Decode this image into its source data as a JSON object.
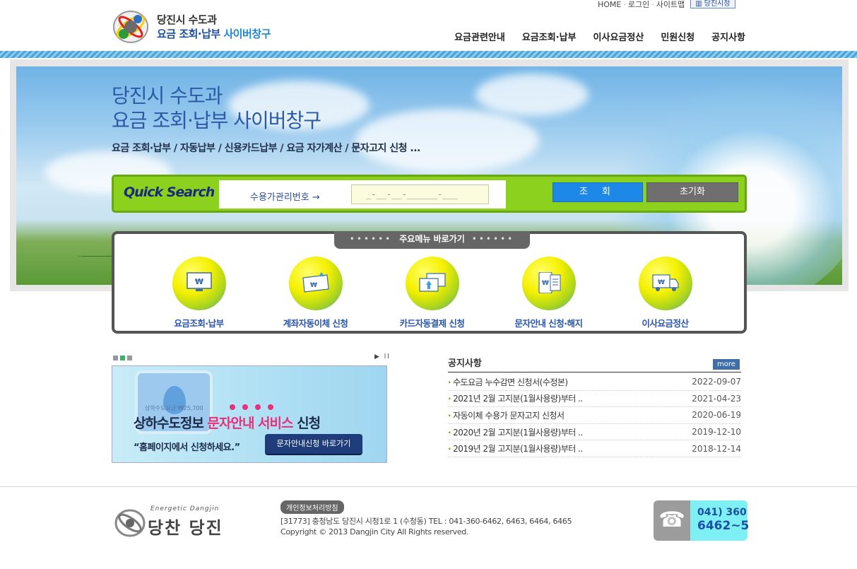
{
  "util": {
    "home": "HOME",
    "login": "로그인",
    "sitemap": "사이트맵",
    "sitemap_btn": "당진시청"
  },
  "logo": {
    "line1": "당진시 수도과",
    "line2a": "요금 조회·납부 ",
    "line2b": "사이버창구"
  },
  "gnb": [
    "요금관련안내",
    "요금조회·납부",
    "이사요금정산",
    "민원신청",
    "공지사항"
  ],
  "hero": {
    "title1": "당진시 수도과",
    "title2": "요금 조회·납부 사이버창구",
    "subtitle": "요금 조회·납부 / 자동납부 / 신용카드납부 / 요금 자가계산 / 문자고지 신청 ..."
  },
  "quick_search": {
    "logo": "Quick Search",
    "label": "수용가관리번호  →",
    "input_value": "_-__-__-______-___",
    "search_btn": "조 회",
    "reset_btn": "초기화"
  },
  "main_menu": {
    "tab_title": "주요메뉴 바로가기",
    "dots": "••••••",
    "items": [
      {
        "label": "요금조회·납부",
        "icon": "monitor-won-icon"
      },
      {
        "label": "계좌자동이체 신청",
        "icon": "bankbook-won-icon"
      },
      {
        "label": "카드자동결제 신청",
        "icon": "card-won-icon"
      },
      {
        "label": "문자안내 신청·해지",
        "icon": "phone-message-icon"
      },
      {
        "label": "이사요금정산",
        "icon": "moving-truck-icon"
      }
    ]
  },
  "banner": {
    "play_pause": "▶ ll",
    "small_text": "상하수도요금 ₩25,700",
    "headline_a": "상하수도정보 ",
    "headline_b": "문자안내 서비스",
    "headline_c": " 신청",
    "quote": "“홈페이지에서 신청하세요.”",
    "button": "문자안내신청 바로가기"
  },
  "notice": {
    "title": "공지사항",
    "more": "more",
    "rows": [
      {
        "title": "수도요금 누수감면 신청서(수정본)",
        "date": "2022-09-07"
      },
      {
        "title": "2021년 2월 고지분(1월사용량)부터 ..",
        "date": "2021-04-23"
      },
      {
        "title": "자동이체 수용가 문자고지 신청서",
        "date": "2020-06-19"
      },
      {
        "title": "2020년 2월 고지분(1월사용량)부터 ..",
        "date": "2019-12-10"
      },
      {
        "title": "2019년 2월 고지분(1월사용량)부터 ..",
        "date": "2018-12-14"
      }
    ]
  },
  "footer": {
    "logo_en": "Energetic Dangjin",
    "logo_kr": "당찬 당진",
    "privacy": "개인정보처리방침",
    "address": "[31773] 충청남도 당진시 시청1로 1 (수청동)   TEL : 041-360-6462, 6463, 6464, 6465",
    "copyright": "Copyright © 2013 Dangjin City All Rights reserved.",
    "phone_a": "041) 360",
    "phone_b": "6462~5",
    "phone_icon": "☎"
  },
  "colors": {
    "brand_blue": "#1d4f9c",
    "quick_green": "#8cd11d",
    "search_blue": "#1e88e8",
    "reset_gray": "#6f6f6f",
    "accent_pink": "#e8307a"
  }
}
